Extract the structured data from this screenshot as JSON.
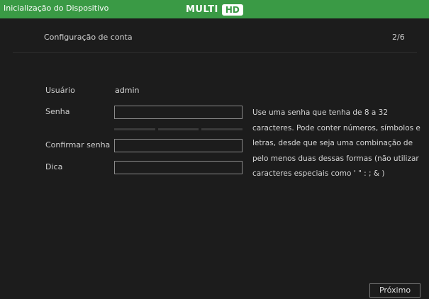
{
  "titlebar": {
    "title": "Inicialização do Dispositivo",
    "logo_multi": "MULTI",
    "logo_hd": "HD"
  },
  "step": {
    "title": "Configuração de conta",
    "counter": "2/6"
  },
  "form": {
    "user_label": "Usuário",
    "user_value": "admin",
    "password_label": "Senha",
    "password_value": "",
    "confirm_label": "Confirmar senha",
    "confirm_value": "",
    "hint_label": "Dica",
    "hint_value": ""
  },
  "help_text": "Use uma senha que tenha de 8 a 32 caracteres. Pode conter números, símbolos e letras, desde que seja uma combinação de pelo menos duas dessas formas (não utilizar caracteres especiais como ' \" : ; & )",
  "buttons": {
    "next_label": "Próximo"
  },
  "colors": {
    "accent": "#3a9a45",
    "background": "#1c1c1c"
  }
}
